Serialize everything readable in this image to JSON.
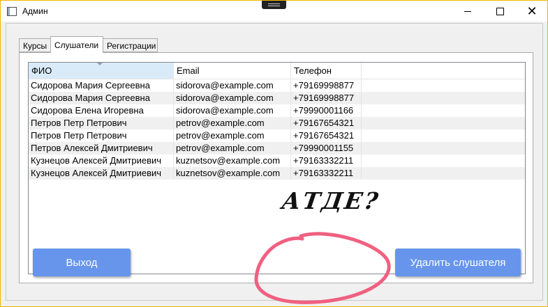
{
  "window": {
    "title": "Админ"
  },
  "tabs": [
    {
      "label": "Курсы"
    },
    {
      "label": "Слушатели"
    },
    {
      "label": "Регистрации"
    }
  ],
  "grid": {
    "columns": [
      "ФИО",
      "Email",
      "Телефон"
    ],
    "rows": [
      [
        "Сидорова Мария Сергеевна",
        "sidorova@example.com",
        "+79169998877"
      ],
      [
        "Сидорова Мария Сергеевна",
        "sidorova@example.com",
        "+79169998877"
      ],
      [
        "Сидорова Елена Игоревна",
        "sidorova@example.com",
        "+79990001166"
      ],
      [
        "Петров Петр Петрович",
        "petrov@example.com",
        "+79167654321"
      ],
      [
        "Петров Петр Петрович",
        "petrov@example.com",
        "+79167654321"
      ],
      [
        "Петров Алексей Дмитриевич",
        "petrov@example.com",
        "+79990001155"
      ],
      [
        "Кузнецов Алексей Дмитриевич",
        "kuznetsov@example.com",
        "+79163332211"
      ],
      [
        "Кузнецов Алексей Дмитриевич",
        "kuznetsov@example.com",
        "+79163332211"
      ]
    ]
  },
  "buttons": {
    "exit": "Выход",
    "delete": "Удалить слушателя"
  },
  "annotation": {
    "text": "АТДЕ?"
  },
  "colors": {
    "button": "#6795ec",
    "scribble": "#f06080",
    "window_border": "#f0b400"
  }
}
